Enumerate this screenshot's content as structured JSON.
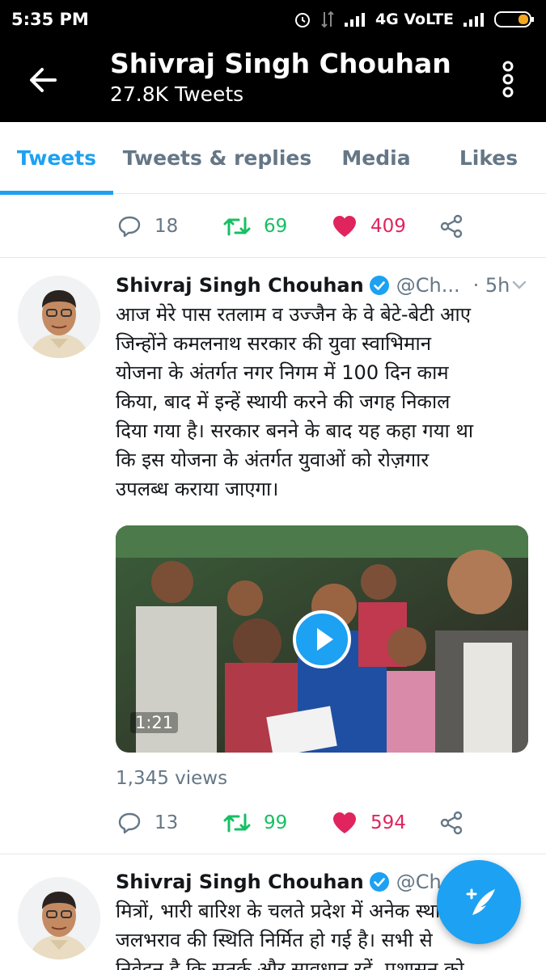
{
  "status_bar": {
    "time": "5:35 PM",
    "network": "4G VoLTE"
  },
  "header": {
    "title": "Shivraj Singh Chouhan",
    "subtitle": "27.8K Tweets"
  },
  "tabs": [
    {
      "label": "Tweets",
      "active": true
    },
    {
      "label": "Tweets & replies",
      "active": false
    },
    {
      "label": "Media",
      "active": false
    },
    {
      "label": "Likes",
      "active": false
    }
  ],
  "top_actions": {
    "replies": "18",
    "retweets": "69",
    "likes": "409"
  },
  "tweets": [
    {
      "name": "Shivraj Singh Chouhan",
      "handle": "@Ch...",
      "time": "· 5h",
      "text": "आज मेरे पास रतलाम व उज्जैन के वे बेटे-बेटी आए\nजिन्होंने कमलनाथ सरकार की युवा स्वाभिमान\nयोजना के अंतर्गत नगर निगम में 100 दिन काम\nकिया, बाद में इन्हें स्थायी करने की जगह निकाल\nदिया गया है। सरकार बनने के बाद यह कहा गया था\nकि इस योजना के अंतर्गत युवाओं को रोज़गार\nउपलब्ध कराया जाएगा।",
      "video_duration": "1:21",
      "views": "1,345 views",
      "replies": "13",
      "retweets": "99",
      "likes": "594"
    },
    {
      "name": "Shivraj Singh Chouhan",
      "handle": "@Ch...",
      "text": "मित्रों, भारी बारिश के चलते प्रदेश में अनेक स्थानों पर\nजलभराव की स्थिति निर्मित हो गई है। सभी से\nनिवेदन है कि सतर्क और सावधान रहें, प्रशासन को"
    }
  ],
  "colors": {
    "accent": "#1da1f2",
    "retweet": "#17bf63",
    "like": "#e0245e",
    "muted": "#657786"
  },
  "icons": [
    "back-arrow-icon",
    "overflow-menu-icon",
    "reply-icon",
    "retweet-icon",
    "heart-icon",
    "share-icon",
    "verified-icon",
    "caret-down-icon",
    "play-icon",
    "compose-tweet-icon"
  ]
}
